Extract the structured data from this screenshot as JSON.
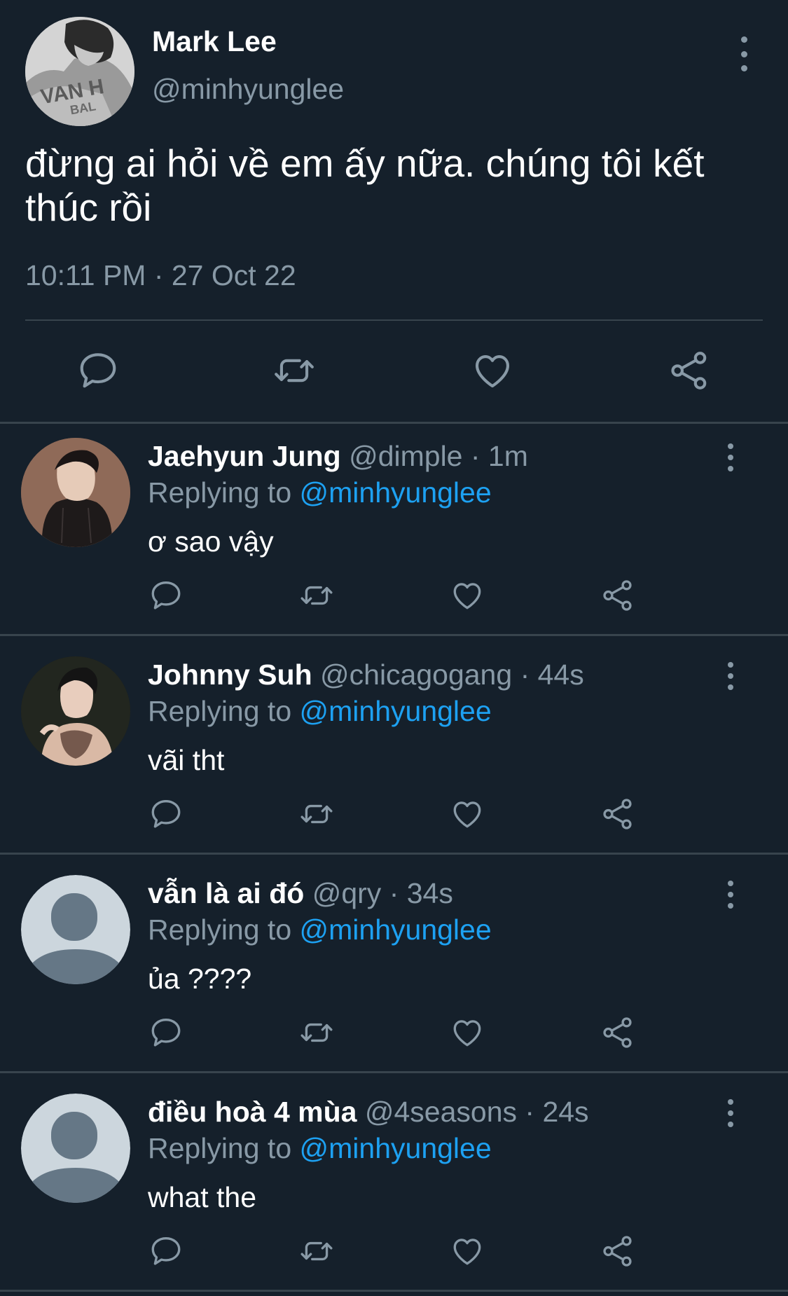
{
  "main_tweet": {
    "name": "Mark Lee",
    "handle": "@minhyunglee",
    "text": "đừng ai hỏi về em ấy nữa. chúng tôi kết thúc rồi",
    "timestamp": "10:11 PM · 27 Oct 22",
    "avatar_text": "VAN H",
    "avatar_subtext": "BAL"
  },
  "replies": [
    {
      "name": "Jaehyun Jung",
      "handle": "@dimple",
      "time": "· 1m",
      "replying_label": "Replying to",
      "mention": "@minhyunglee",
      "text": "ơ sao vậy"
    },
    {
      "name": "Johnny Suh",
      "handle": "@chicagogang",
      "time": "· 44s",
      "replying_label": "Replying to",
      "mention": "@minhyunglee",
      "text": "vãi tht"
    },
    {
      "name": "vẫn là ai đó",
      "handle": "@qry",
      "time": "· 34s",
      "replying_label": "Replying to",
      "mention": "@minhyunglee",
      "text": "ủa ????"
    },
    {
      "name": "điều hoà 4 mùa",
      "handle": "@4seasons",
      "time": "· 24s",
      "replying_label": "Replying to",
      "mention": "@minhyunglee",
      "text": "what the"
    }
  ],
  "icons": {
    "reply": "reply-icon",
    "retweet": "retweet-icon",
    "like": "heart-icon",
    "share": "share-icon",
    "more": "more-vertical-icon",
    "default_avatar": "default-avatar-icon"
  },
  "colors": {
    "background": "#15202b",
    "divider": "#38444d",
    "secondary_text": "#8899a6",
    "link": "#1da1f2"
  }
}
